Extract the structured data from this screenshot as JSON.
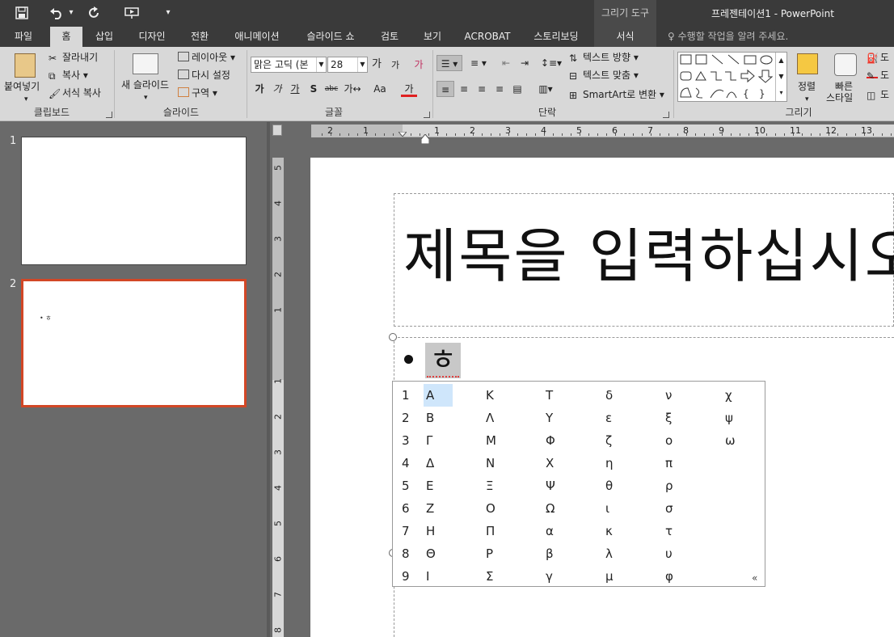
{
  "app": {
    "doc_title": "프레젠테이션1 - PowerPoint",
    "context_header": "그리기 도구"
  },
  "qat": {
    "save": "💾",
    "undo": "↶",
    "undo_dd": "▾",
    "redo": "↻",
    "present": "⏵",
    "customize": "▾"
  },
  "tabs": [
    {
      "label": "파일",
      "active": false
    },
    {
      "label": "홈",
      "active": true
    },
    {
      "label": "삽입",
      "active": false
    },
    {
      "label": "디자인",
      "active": false
    },
    {
      "label": "전환",
      "active": false
    },
    {
      "label": "애니메이션",
      "active": false
    },
    {
      "label": "슬라이드 쇼",
      "active": false
    },
    {
      "label": "검토",
      "active": false
    },
    {
      "label": "보기",
      "active": false
    },
    {
      "label": "ACROBAT",
      "active": false
    },
    {
      "label": "스토리보딩",
      "active": false
    },
    {
      "label": "서식",
      "active": false,
      "contextual": true
    }
  ],
  "tell_me": "수행할 작업을 알려 주세요.",
  "ribbon": {
    "clipboard": {
      "label": "클립보드",
      "paste": "붙여넣기",
      "cut": "잘라내기",
      "copy": "복사",
      "format_painter": "서식 복사"
    },
    "slides": {
      "label": "슬라이드",
      "new_slide": "새 슬라이드",
      "layout": "레이아웃",
      "reset": "다시 설정",
      "section": "구역"
    },
    "font": {
      "label": "글꼴",
      "font_name": "맑은 고딕 (본",
      "font_size": "28",
      "grow": "가",
      "shrink": "가",
      "clear": "가",
      "bold": "가",
      "italic": "가",
      "underline": "가",
      "shadow": "S",
      "strike": "abc",
      "spacing": "가↔",
      "case": "Aa",
      "color": "가",
      "color_hex": "#e02020"
    },
    "paragraph": {
      "label": "단락",
      "text_direction": "텍스트 방향",
      "align_text": "텍스트 맞춤",
      "smartart": "SmartArt로 변환"
    },
    "drawing": {
      "label": "그리기",
      "arrange": "정렬",
      "quick_styles_1": "빠른",
      "quick_styles_2": "스타일",
      "fill": "도",
      "outline": "도",
      "effects": "도"
    }
  },
  "slides": [
    {
      "number": "1",
      "selected": false,
      "preview_text": ""
    },
    {
      "number": "2",
      "selected": true,
      "preview_text": "• ㅎ"
    }
  ],
  "ruler": {
    "h": [
      "2",
      "1",
      "1",
      "2",
      "3",
      "4",
      "5",
      "6",
      "7",
      "8",
      "9",
      "10",
      "11",
      "12",
      "13"
    ],
    "v": [
      "5",
      "4",
      "3",
      "2",
      "1",
      "1",
      "2",
      "3",
      "4",
      "5",
      "6",
      "7",
      "8"
    ]
  },
  "slide": {
    "title_placeholder": "제목을 입력하십시오",
    "composing_char": "ㅎ"
  },
  "hanja_popup": {
    "numbers": [
      "1",
      "2",
      "3",
      "4",
      "5",
      "6",
      "7",
      "8",
      "9"
    ],
    "columns": [
      [
        "Α",
        "Β",
        "Γ",
        "Δ",
        "Ε",
        "Ζ",
        "Η",
        "Θ",
        "Ι"
      ],
      [
        "Κ",
        "Λ",
        "Μ",
        "Ν",
        "Ξ",
        "Ο",
        "Π",
        "Ρ",
        "Σ"
      ],
      [
        "Τ",
        "Υ",
        "Φ",
        "Χ",
        "Ψ",
        "Ω",
        "α",
        "β",
        "γ"
      ],
      [
        "δ",
        "ε",
        "ζ",
        "η",
        "θ",
        "ι",
        "κ",
        "λ",
        "μ"
      ],
      [
        "ν",
        "ξ",
        "ο",
        "π",
        "ρ",
        "σ",
        "τ",
        "υ",
        "φ"
      ],
      [
        "χ",
        "ψ",
        "ω",
        "",
        "",
        "",
        "",
        "",
        ""
      ]
    ],
    "selected_index": 0,
    "expand_glyph": "«"
  }
}
